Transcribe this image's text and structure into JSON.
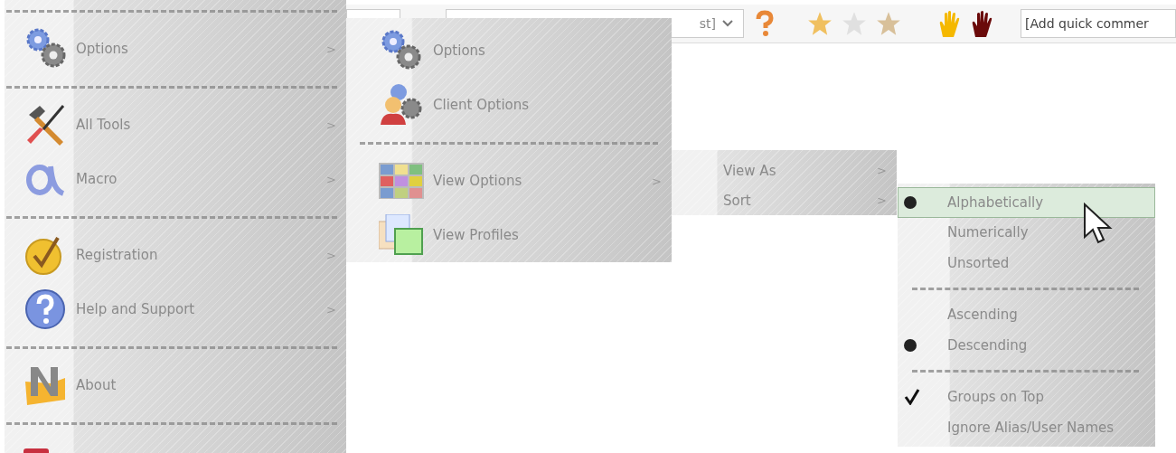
{
  "toolbar": {
    "dropdown": {
      "value": "st]"
    },
    "comment_field": {
      "placeholder": "[Add quick commer"
    }
  },
  "main_menu": [
    {
      "kind": "separator"
    },
    {
      "kind": "item",
      "label": "Options",
      "arrow": ">"
    },
    {
      "kind": "separator"
    },
    {
      "kind": "item",
      "label": "All Tools",
      "arrow": ">"
    },
    {
      "kind": "item",
      "label": "Macro",
      "arrow": ">"
    },
    {
      "kind": "separator"
    },
    {
      "kind": "item",
      "label": "Registration",
      "arrow": ">"
    },
    {
      "kind": "item",
      "label": "Help and Support",
      "arrow": ">"
    },
    {
      "kind": "separator"
    },
    {
      "kind": "item",
      "label": "About"
    },
    {
      "kind": "separator"
    },
    {
      "kind": "item"
    }
  ],
  "options_menu": [
    {
      "kind": "item",
      "label": "Options"
    },
    {
      "kind": "item",
      "label": "Client Options"
    },
    {
      "kind": "separator"
    },
    {
      "kind": "item",
      "label": "View Options",
      "arrow": ">"
    },
    {
      "kind": "item",
      "label": "View Profiles"
    }
  ],
  "view_menu": [
    {
      "label": "View As",
      "arrow": ">"
    },
    {
      "label": "Sort",
      "arrow": ">"
    }
  ],
  "sort_menu": [
    {
      "kind": "radio",
      "label": "Alphabetically",
      "checked": true,
      "selected": true
    },
    {
      "kind": "radio",
      "label": "Numerically",
      "checked": false,
      "selected": false
    },
    {
      "kind": "radio",
      "label": "Unsorted",
      "checked": false,
      "selected": false
    },
    {
      "kind": "separator"
    },
    {
      "kind": "radio",
      "label": "Ascending",
      "checked": false,
      "selected": false
    },
    {
      "kind": "radio",
      "label": "Descending",
      "checked": true,
      "selected": false
    },
    {
      "kind": "separator"
    },
    {
      "kind": "check",
      "label": "Groups on Top",
      "checked": true,
      "selected": false
    },
    {
      "kind": "check",
      "label": "Ignore Alias/User Names",
      "checked": false,
      "selected": false
    }
  ]
}
